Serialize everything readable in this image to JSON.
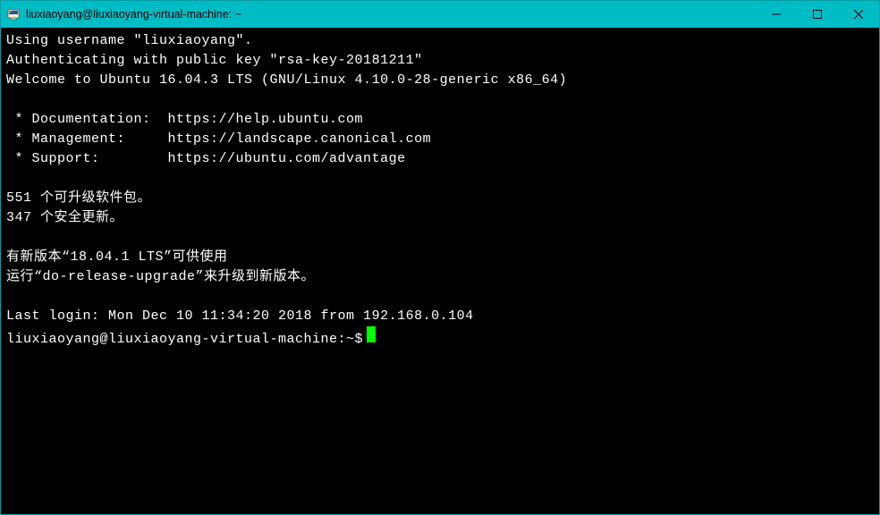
{
  "window": {
    "title": "liuxiaoyang@liuxiaoyang-virtual-machine: ~"
  },
  "terminal": {
    "lines": [
      "Using username \"liuxiaoyang\".",
      "Authenticating with public key \"rsa-key-20181211\"",
      "Welcome to Ubuntu 16.04.3 LTS (GNU/Linux 4.10.0-28-generic x86_64)",
      "",
      " * Documentation:  https://help.ubuntu.com",
      " * Management:     https://landscape.canonical.com",
      " * Support:        https://ubuntu.com/advantage",
      "",
      "551 个可升级软件包。",
      "347 个安全更新。",
      "",
      "有新版本“18.04.1 LTS”可供使用",
      "运行“do-release-upgrade”来升级到新版本。",
      "",
      "Last login: Mon Dec 10 11:34:20 2018 from 192.168.0.104"
    ],
    "prompt": "liuxiaoyang@liuxiaoyang-virtual-machine:~$"
  }
}
